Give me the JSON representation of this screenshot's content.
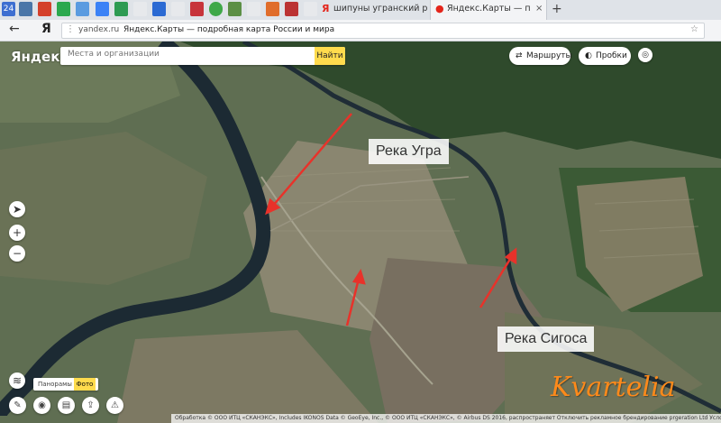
{
  "browser": {
    "tab_badge": "24",
    "tabs": [
      {
        "title": "шипуны угранский район",
        "icon": "yandex-search-icon"
      },
      {
        "title": "Яндекс.Карты — подробна",
        "icon": "yandex-maps-pin-icon",
        "active": true
      }
    ],
    "new_tab": "+",
    "back": "←",
    "brand_glyph": "Я",
    "url_domain": "yandex.ru",
    "page_title": "Яндекс.Карты — подробная карта России и мира",
    "colors": {
      "accent_yellow": "#ffdb4d",
      "arrow_red": "#e8322a",
      "watermark": "#ff8a1a"
    }
  },
  "map": {
    "logo": "Яндекс",
    "search": {
      "placeholder": "Места и организации",
      "button": "Найти"
    },
    "routes_button": "Маршруты",
    "traffic_button": "Пробки",
    "labels": {
      "ugra": "Река Угра",
      "sigosa": "Река Сигоса"
    },
    "watermark": "Kvartelia",
    "layers": {
      "panorama": "Панорамы",
      "photo": "Фото"
    },
    "zoom_in": "+",
    "zoom_out": "−",
    "copyright": "Обработка © ООО ИТЦ «СКАНЭКС», Includes IKONOS Data © GeoEye, Inc., © ООО ИТЦ «СКАНЭКС», © Airbus DS 2016, распространяет Отключить рекламное брендирование prgeration Ltd   Условия использ"
  }
}
